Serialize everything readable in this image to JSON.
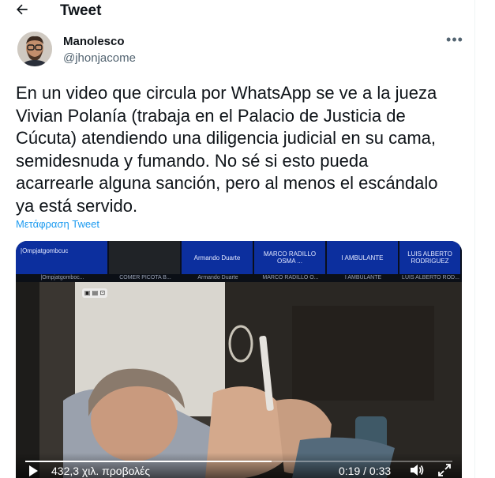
{
  "header": {
    "title": "Tweet",
    "back_icon": "arrow-left-icon"
  },
  "author": {
    "display_name": "Manolesco",
    "handle": "@jhonjacome",
    "more_icon": "ellipsis-icon"
  },
  "tweet": {
    "lines": [
      "En un video que circula por WhatsApp se ve a la jueza",
      "Vivian Polanía (trabaja en el Palacio de Justicia de",
      "Cúcuta) atendiendo una diligencia judicial en su cama,",
      "semidesnuda y fumando. No sé si esto pueda",
      "acarrearle alguna sanción, pero al menos el escándalo",
      "ya está servido."
    ],
    "translate_label": "Μετάφραση Tweet"
  },
  "video": {
    "participant_tiles": [
      "|Ompjatgombcuc",
      "",
      "Armando Duarte",
      "MARCO RADILLO OSMA ...",
      "I AMBULANTE",
      "LUIS ALBERTO RODRIGUEZ"
    ],
    "name_strip": [
      "|Ompjatgomboc...",
      "COMER PICOTA B...",
      "Armando Duarte",
      "MARCO RADILLO O...",
      "I AMBULANTE",
      "LUIS ALBERTO ROD..."
    ],
    "play_icon": "play-icon",
    "views": "432,3 χιλ. προβολές",
    "time": "0:19 / 0:33",
    "progress": 0.576,
    "volume_icon": "volume-icon",
    "fullscreen_icon": "fullscreen-icon"
  },
  "colors": {
    "accent": "#1d9bf0",
    "text": "#0f1419",
    "muted": "#536471"
  }
}
